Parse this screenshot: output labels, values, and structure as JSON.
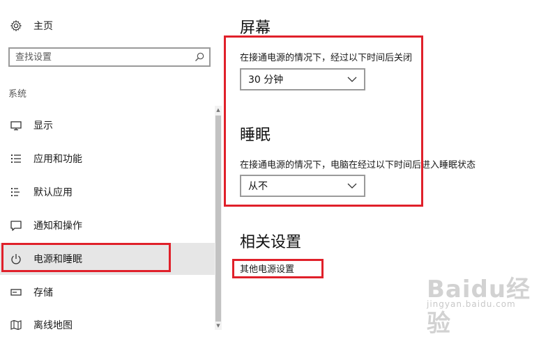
{
  "sidebar": {
    "home_label": "主页",
    "search_placeholder": "查找设置",
    "section_label": "系统",
    "items": [
      {
        "label": "显示"
      },
      {
        "label": "应用和功能"
      },
      {
        "label": "默认应用"
      },
      {
        "label": "通知和操作"
      },
      {
        "label": "电源和睡眠"
      },
      {
        "label": "存储"
      },
      {
        "label": "离线地图"
      }
    ]
  },
  "main": {
    "screen": {
      "title": "屏幕",
      "description": "在接通电源的情况下，经过以下时间后关闭",
      "value": "30 分钟"
    },
    "sleep": {
      "title": "睡眠",
      "description": "在接通电源的情况下，电脑在经过以下时间后进入睡眠状态",
      "value": "从不"
    },
    "related": {
      "title": "相关设置",
      "link": "其他电源设置"
    }
  },
  "watermark": {
    "brand": "Baidu经验",
    "url": "jingyan.baidu.com"
  },
  "colors": {
    "highlight": "#e0202a",
    "selected_bg": "#e6e6e6"
  }
}
